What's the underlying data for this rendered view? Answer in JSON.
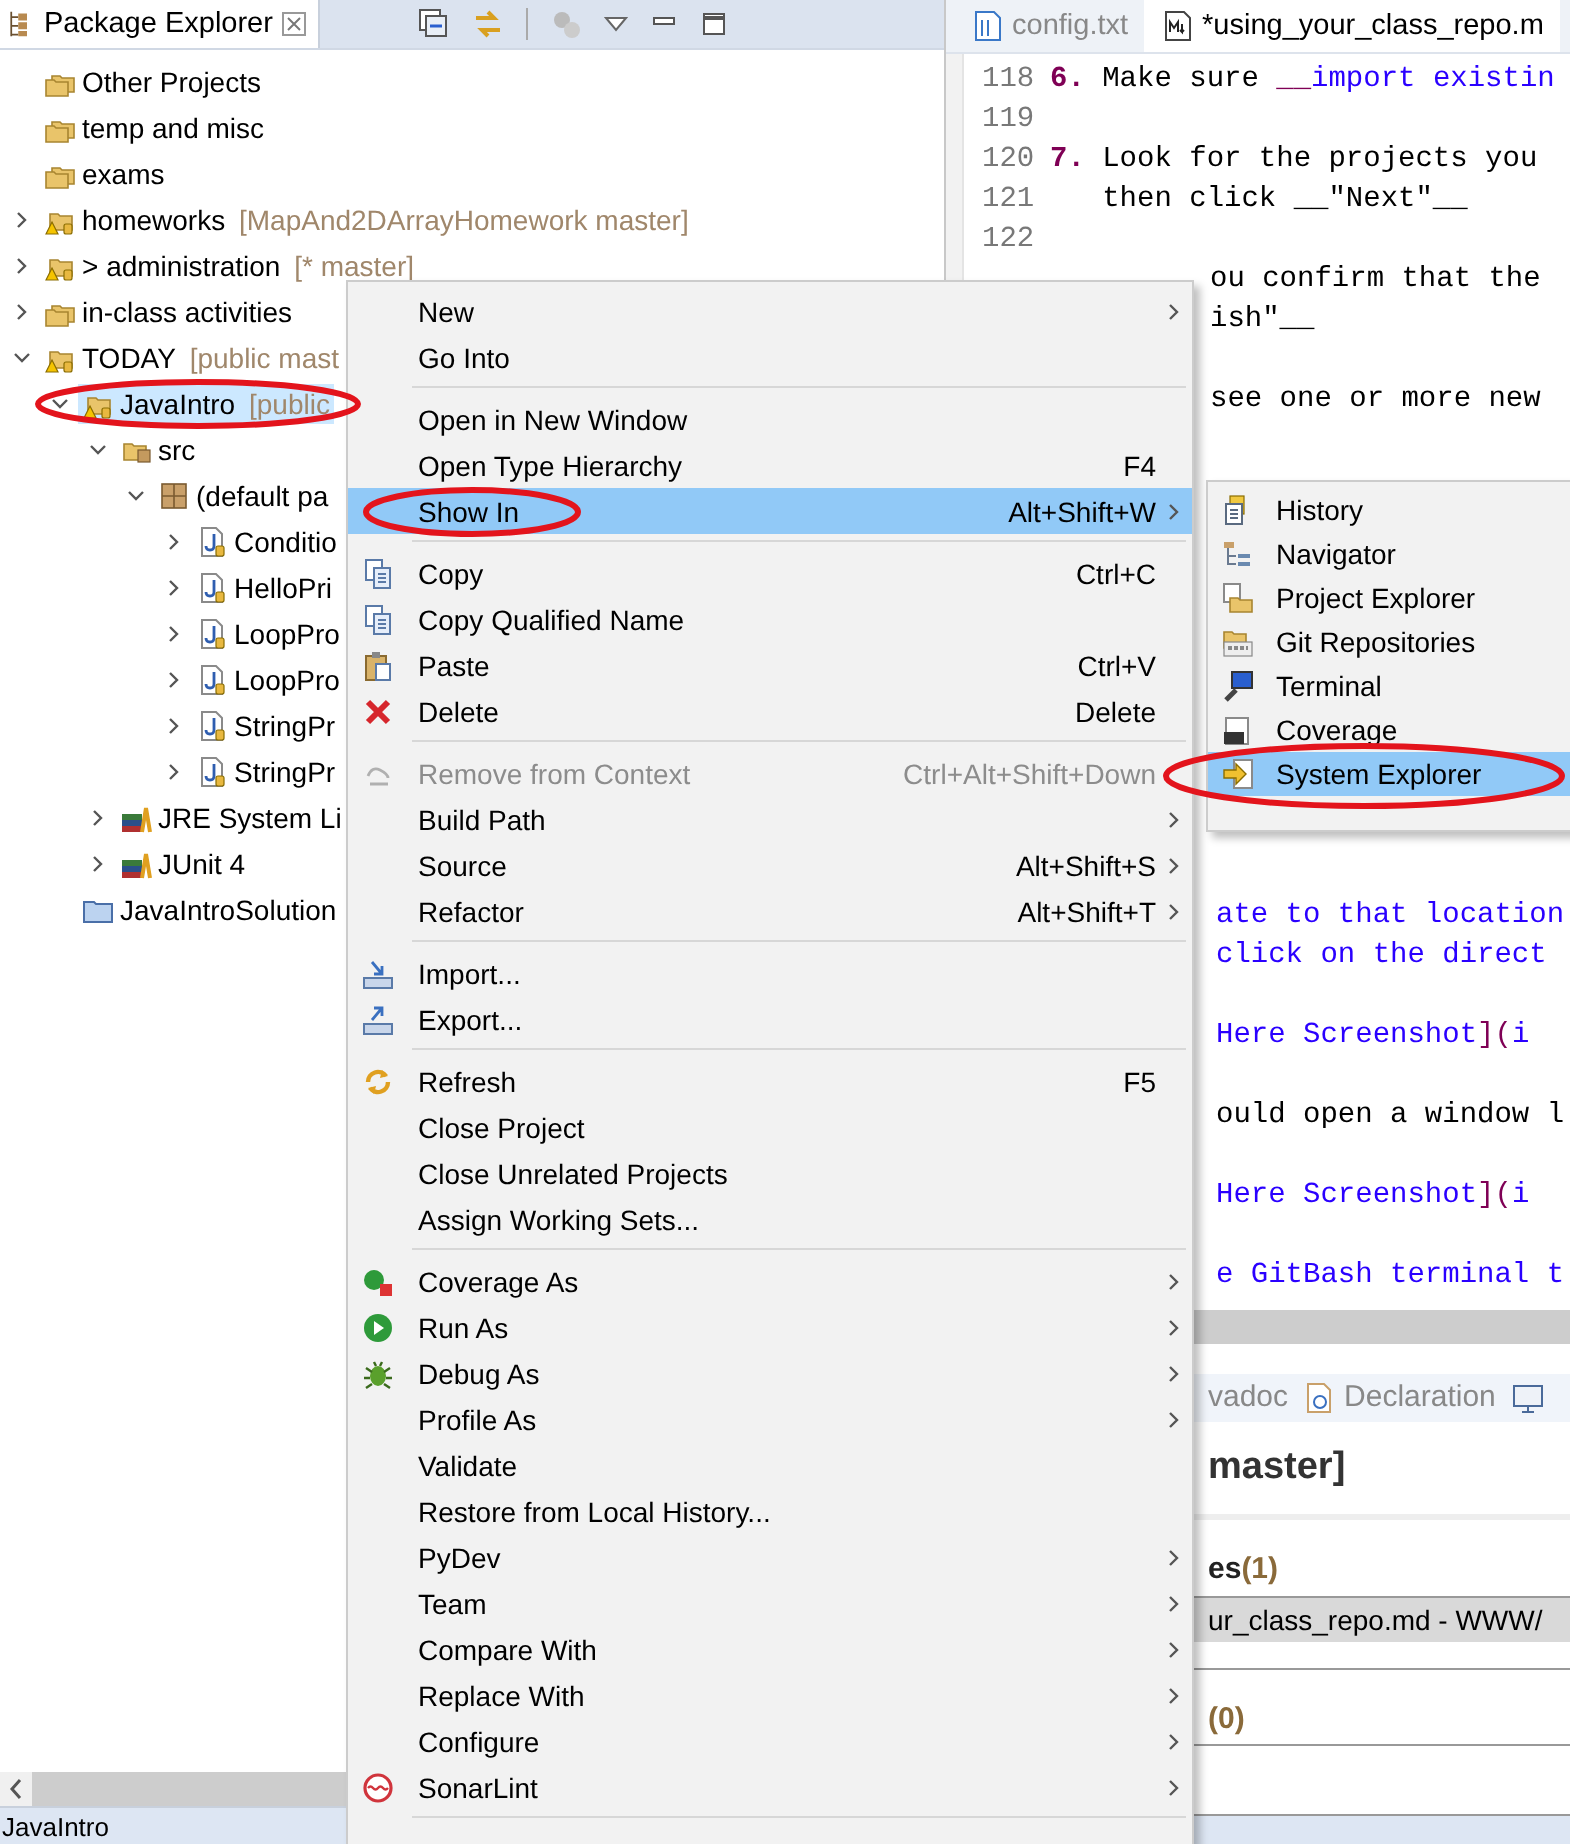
{
  "package_explorer": {
    "title": "Package Explorer",
    "tree": [
      {
        "label": "Other Projects",
        "kind": "working_set",
        "selected": false
      },
      {
        "label": "temp and misc",
        "kind": "working_set",
        "selected": false
      },
      {
        "label": "exams",
        "kind": "working_set",
        "selected": false
      },
      {
        "label": "homeworks",
        "decoration": "[MapAnd2DArrayHomework master]",
        "kind": "project",
        "expanded": false,
        "selected": false
      },
      {
        "label": "> administration",
        "decoration": "[* master]",
        "kind": "project",
        "expanded": false,
        "selected": false
      },
      {
        "label": "in-class activities",
        "kind": "working_set",
        "expanded": false,
        "selected": false
      },
      {
        "label": "TODAY",
        "decoration": "[public mast",
        "kind": "project",
        "expanded": true,
        "selected": false,
        "children": [
          {
            "label": "JavaIntro",
            "decoration": "[public",
            "kind": "project",
            "expanded": true,
            "selected": true,
            "children": [
              {
                "label": "src",
                "kind": "package_root",
                "expanded": true,
                "selected": false,
                "children": [
                  {
                    "label": "(default pa",
                    "kind": "package",
                    "expanded": true,
                    "selected": false,
                    "children": [
                      {
                        "label": "Conditio",
                        "kind": "java_file",
                        "expanded": false,
                        "selected": false
                      },
                      {
                        "label": "HelloPri",
                        "kind": "java_file",
                        "expanded": false,
                        "selected": false
                      },
                      {
                        "label": "LoopPro",
                        "kind": "java_file",
                        "expanded": false,
                        "selected": false
                      },
                      {
                        "label": "LoopPro",
                        "kind": "java_file",
                        "expanded": false,
                        "selected": false
                      },
                      {
                        "label": "StringPr",
                        "kind": "java_file",
                        "expanded": false,
                        "selected": false
                      },
                      {
                        "label": "StringPr",
                        "kind": "java_file",
                        "expanded": false,
                        "selected": false
                      }
                    ]
                  }
                ]
              },
              {
                "label": "JRE System Li",
                "kind": "library",
                "expanded": false,
                "selected": false
              },
              {
                "label": "JUnit 4",
                "kind": "library",
                "expanded": false,
                "selected": false
              }
            ]
          },
          {
            "label": "JavaIntroSolution",
            "kind": "folder",
            "selected": false
          }
        ]
      }
    ],
    "bottom_label": "JavaIntro"
  },
  "editor": {
    "tabs": [
      {
        "label": "config.txt",
        "kind": "text",
        "selected": false
      },
      {
        "label": "*using_your_class_repo.m",
        "kind": "markdown",
        "selected": true
      }
    ],
    "upper_lines": [
      {
        "kind": "numbered",
        "number": "118",
        "parts": [
          {
            "text": "6.",
            "kind": "marker"
          },
          {
            "text": " Make sure ",
            "kind": "plain"
          },
          {
            "text": "__",
            "kind": "emphasis"
          },
          {
            "text": "import existin",
            "kind": "link"
          }
        ]
      },
      {
        "kind": "numbered",
        "number": "119"
      },
      {
        "kind": "numbered",
        "number": "120",
        "parts": [
          {
            "text": "7.",
            "kind": "marker"
          },
          {
            "text": " Look for the projects you",
            "kind": "plain"
          }
        ]
      },
      {
        "kind": "numbered",
        "number": "121",
        "parts": [
          {
            "text": "   then click __\"Next\"__",
            "kind": "plain"
          }
        ]
      },
      {
        "kind": "numbered",
        "number": "122"
      },
      {
        "kind": "covered",
        "parts": [
          {
            "text": "ou confirm that the",
            "kind": "plain"
          }
        ]
      },
      {
        "kind": "covered",
        "parts": [
          {
            "text": "ish\"__",
            "kind": "plain"
          }
        ]
      },
      {
        "kind": "blank"
      },
      {
        "kind": "covered",
        "parts": [
          {
            "text": "see one or more new",
            "kind": "plain"
          }
        ]
      }
    ],
    "lower_lines": [
      {
        "kind": "covered",
        "parts": [
          {
            "text": "ate to that location",
            "kind": "link"
          }
        ]
      },
      {
        "kind": "covered",
        "parts": [
          {
            "text": "click on the direct",
            "kind": "link"
          }
        ]
      },
      {
        "kind": "blank"
      },
      {
        "kind": "covered",
        "parts": [
          {
            "text": "Here Screenshot",
            "kind": "link"
          },
          {
            "text": "](",
            "kind": "emphasis"
          },
          {
            "text": "i",
            "kind": "link"
          }
        ]
      },
      {
        "kind": "blank"
      },
      {
        "kind": "covered",
        "parts": [
          {
            "text": "ould open a window l",
            "kind": "plain"
          }
        ]
      },
      {
        "kind": "blank"
      },
      {
        "kind": "covered",
        "parts": [
          {
            "text": "Here Screenshot",
            "kind": "link"
          },
          {
            "text": "](",
            "kind": "emphasis"
          },
          {
            "text": "i",
            "kind": "link"
          }
        ]
      },
      {
        "kind": "blank"
      },
      {
        "kind": "covered",
        "parts": [
          {
            "text": "e GitBash terminal t",
            "kind": "link"
          }
        ]
      }
    ]
  },
  "bottom_panel": {
    "tabs": [
      {
        "label": "vadoc",
        "selected": false
      },
      {
        "label": "Declaration",
        "selected": false
      }
    ],
    "heading": "master]",
    "sections": [
      {
        "label": "es",
        "count": "(1)",
        "rows": [
          {
            "text": "ur_class_repo.md - WWW/",
            "selected": true
          }
        ]
      },
      {
        "count": "(0)"
      }
    ]
  },
  "context_menu": {
    "items": [
      {
        "kind": "item",
        "label": "New",
        "submenu": true,
        "selected": false,
        "disabled": false
      },
      {
        "kind": "item",
        "label": "Go Into",
        "submenu": false,
        "selected": false,
        "disabled": false
      },
      {
        "kind": "separator"
      },
      {
        "kind": "item",
        "label": "Open in New Window",
        "submenu": false,
        "selected": false,
        "disabled": false
      },
      {
        "kind": "item",
        "label": "Open Type Hierarchy",
        "shortcut": "F4",
        "submenu": false,
        "selected": false,
        "disabled": false
      },
      {
        "kind": "item",
        "label": "Show In",
        "shortcut": "Alt+Shift+W",
        "submenu": true,
        "selected": true,
        "disabled": false
      },
      {
        "kind": "separator"
      },
      {
        "kind": "item",
        "label": "Copy",
        "shortcut": "Ctrl+C",
        "submenu": false,
        "selected": false,
        "disabled": false
      },
      {
        "kind": "item",
        "label": "Copy Qualified Name",
        "submenu": false,
        "selected": false,
        "disabled": false
      },
      {
        "kind": "item",
        "label": "Paste",
        "shortcut": "Ctrl+V",
        "submenu": false,
        "selected": false,
        "disabled": false
      },
      {
        "kind": "item",
        "label": "Delete",
        "shortcut": "Delete",
        "submenu": false,
        "selected": false,
        "disabled": false
      },
      {
        "kind": "separator"
      },
      {
        "kind": "item",
        "label": "Remove from Context",
        "shortcut": "Ctrl+Alt+Shift+Down",
        "submenu": false,
        "selected": false,
        "disabled": true
      },
      {
        "kind": "item",
        "label": "Build Path",
        "submenu": true,
        "selected": false,
        "disabled": false
      },
      {
        "kind": "item",
        "label": "Source",
        "shortcut": "Alt+Shift+S",
        "submenu": true,
        "selected": false,
        "disabled": false
      },
      {
        "kind": "item",
        "label": "Refactor",
        "shortcut": "Alt+Shift+T",
        "submenu": true,
        "selected": false,
        "disabled": false
      },
      {
        "kind": "separator"
      },
      {
        "kind": "item",
        "label": "Import...",
        "submenu": false,
        "selected": false,
        "disabled": false
      },
      {
        "kind": "item",
        "label": "Export...",
        "submenu": false,
        "selected": false,
        "disabled": false
      },
      {
        "kind": "separator"
      },
      {
        "kind": "item",
        "label": "Refresh",
        "shortcut": "F5",
        "submenu": false,
        "selected": false,
        "disabled": false
      },
      {
        "kind": "item",
        "label": "Close Project",
        "submenu": false,
        "selected": false,
        "disabled": false
      },
      {
        "kind": "item",
        "label": "Close Unrelated Projects",
        "submenu": false,
        "selected": false,
        "disabled": false
      },
      {
        "kind": "item",
        "label": "Assign Working Sets...",
        "submenu": false,
        "selected": false,
        "disabled": false
      },
      {
        "kind": "separator"
      },
      {
        "kind": "item",
        "label": "Coverage As",
        "submenu": true,
        "selected": false,
        "disabled": false
      },
      {
        "kind": "item",
        "label": "Run As",
        "submenu": true,
        "selected": false,
        "disabled": false
      },
      {
        "kind": "item",
        "label": "Debug As",
        "submenu": true,
        "selected": false,
        "disabled": false
      },
      {
        "kind": "item",
        "label": "Profile As",
        "submenu": true,
        "selected": false,
        "disabled": false
      },
      {
        "kind": "item",
        "label": "Validate",
        "submenu": false,
        "selected": false,
        "disabled": false
      },
      {
        "kind": "item",
        "label": "Restore from Local History...",
        "submenu": false,
        "selected": false,
        "disabled": false
      },
      {
        "kind": "item",
        "label": "PyDev",
        "submenu": true,
        "selected": false,
        "disabled": false
      },
      {
        "kind": "item",
        "label": "Team",
        "submenu": true,
        "selected": false,
        "disabled": false
      },
      {
        "kind": "item",
        "label": "Compare With",
        "submenu": true,
        "selected": false,
        "disabled": false
      },
      {
        "kind": "item",
        "label": "Replace With",
        "submenu": true,
        "selected": false,
        "disabled": false
      },
      {
        "kind": "item",
        "label": "Configure",
        "submenu": true,
        "selected": false,
        "disabled": false
      },
      {
        "kind": "item",
        "label": "SonarLint",
        "submenu": true,
        "selected": false,
        "disabled": false
      },
      {
        "kind": "separator"
      }
    ]
  },
  "show_in_menu": {
    "items": [
      {
        "label": "History",
        "selected": false
      },
      {
        "label": "Navigator",
        "selected": false
      },
      {
        "label": "Project Explorer",
        "selected": false
      },
      {
        "label": "Git Repositories",
        "selected": false
      },
      {
        "label": "Terminal",
        "selected": false
      },
      {
        "label": "Coverage",
        "selected": false
      },
      {
        "label": "System Explorer",
        "selected": true
      }
    ]
  }
}
